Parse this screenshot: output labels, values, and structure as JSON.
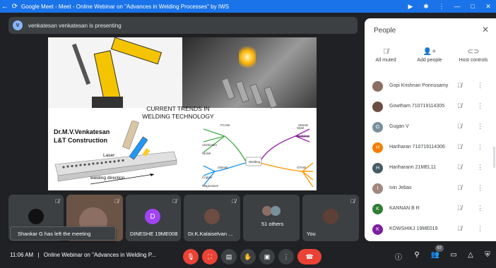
{
  "window": {
    "title": "Google Meet - Meet - Online Webinar on \"Advances in Welding Processes\" by IWS",
    "back_glyph": "←",
    "reload_glyph": "⟳",
    "controls": [
      "▶",
      "✱",
      "⋮",
      "—",
      "□",
      "✕"
    ]
  },
  "presenting": {
    "avatar": "V",
    "text": "venkatesan venkatesan is presenting"
  },
  "slide": {
    "title_line1": "CURRENT TRENDS IN",
    "title_line2": "WELDING TECHNOLOGY",
    "presenter_line1": "Dr.M.V.Venkatesan",
    "presenter_line2": "L&T Construction",
    "laser_label": "Laser",
    "weld_direction_label": "welding direction",
    "mindmap_center": "Welding",
    "mindmap_nodes": [
      "FCAW",
      "SMAW",
      "GMAW",
      "GTAW",
      "Steel",
      "Stainless",
      "Aluminium",
      "Nickel",
      "Copper",
      "Magnesium"
    ]
  },
  "tiles": [
    {
      "name": "",
      "avatar": "",
      "color": "#3c4043"
    },
    {
      "name": "",
      "avatar": "",
      "color": "#7a5a44"
    },
    {
      "name": "DINESHE 19ME008",
      "avatar": "D",
      "color": "#a142f4"
    },
    {
      "name": "Dr.K.Kalaiselvan ...",
      "avatar": "",
      "color": "#5f6368"
    },
    {
      "name": "51 others",
      "avatar": "",
      "color": "#5f6368"
    },
    {
      "name": "You",
      "avatar": "",
      "color": "#5f6368"
    }
  ],
  "toast": "Shankar G has left the meeting",
  "bottom": {
    "time": "11:06 AM",
    "separator": "|",
    "meeting_name": "Online Webinar on \"Advances in Welding P...",
    "participant_count": "67"
  },
  "people_panel": {
    "title": "People",
    "close_glyph": "✕",
    "actions": [
      {
        "label": "All muted",
        "icon": "mic-off-icon"
      },
      {
        "label": "Add people",
        "icon": "add-person-icon"
      },
      {
        "label": "Host controls",
        "icon": "toggle-icon"
      }
    ],
    "participants": [
      {
        "name": "Gopi Krishnan Ponnusamy",
        "avatar": "",
        "color": "#8d6e63"
      },
      {
        "name": "Gowtham 710719114305",
        "avatar": "",
        "color": "#6d4c41"
      },
      {
        "name": "Gugan V",
        "avatar": "G",
        "color": "#78909c"
      },
      {
        "name": "Hariharan 710719114306",
        "avatar": "H",
        "color": "#f57c00"
      },
      {
        "name": "Hariharann 21MEL11",
        "avatar": "H",
        "color": "#455a64"
      },
      {
        "name": "Ivin Jebas",
        "avatar": "I",
        "color": "#a1887f"
      },
      {
        "name": "KANNAN B R",
        "avatar": "K",
        "color": "#2e7d32"
      },
      {
        "name": "KOWSHIKJ 19ME019",
        "avatar": "K",
        "color": "#7b1fa2"
      }
    ]
  }
}
